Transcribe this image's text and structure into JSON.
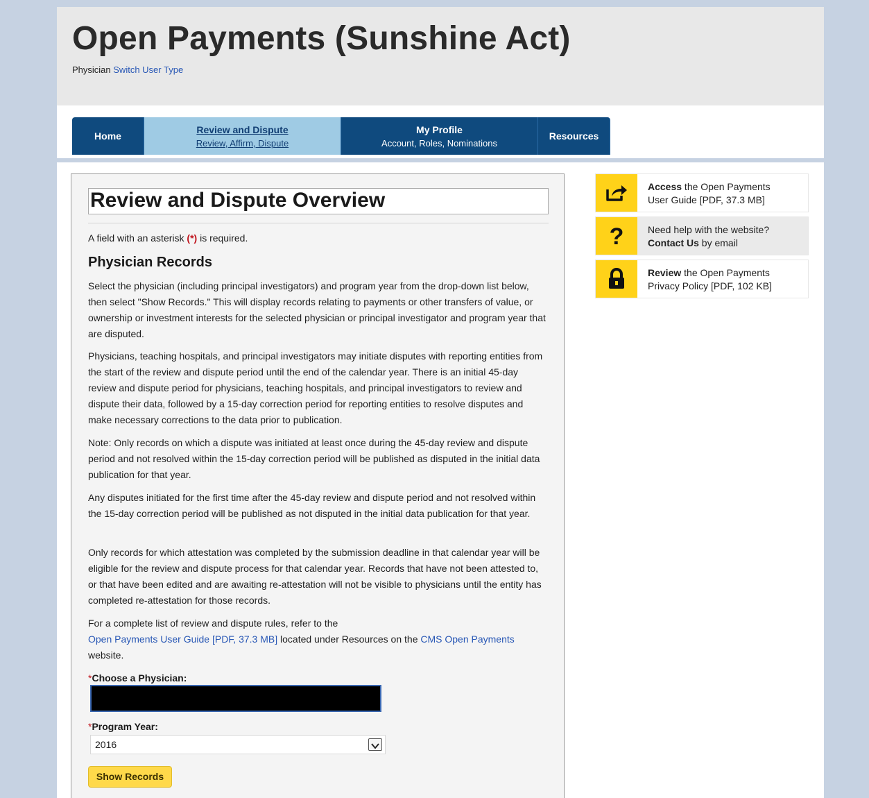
{
  "header": {
    "site_title": "Open Payments (Sunshine Act)",
    "user_type": "Physician",
    "switch_link": "Switch User Type"
  },
  "nav": {
    "home": "Home",
    "review_title": "Review and Dispute",
    "review_sub": "Review, Affirm, Dispute",
    "profile_title": "My Profile",
    "profile_sub": "Account, Roles, Nominations",
    "resources": "Resources"
  },
  "main": {
    "title": "Review and Dispute Overview",
    "required_note_pre": "A field with an asterisk ",
    "required_note_ast": "(*)",
    "required_note_post": " is required.",
    "section_title": "Physician Records",
    "p1": "Select the physician (including principal investigators) and program year from the drop-down list below, then select \"Show Records.\" This will display records relating to payments or other transfers of value, or ownership or investment interests for the selected physician or principal investigator and program year that are disputed.",
    "p2": "Physicians, teaching hospitals, and principal investigators may initiate disputes with reporting entities from the start of the review and dispute period until the end of the calendar year. There is an initial 45-day review and dispute period for physicians, teaching hospitals, and principal investigators to review and dispute their data, followed by a 15-day correction period for reporting entities to resolve disputes and make necessary corrections to the data prior to publication.",
    "p3": "Note: Only records on which a dispute was initiated at least once during the 45-day review and dispute period and not resolved within the 15-day correction period will be published as disputed in the initial data publication for that year.",
    "p4": "Any disputes initiated for the first time after the 45-day review and dispute period and not resolved within the 15-day correction period will be published as not disputed in the initial data publication for that year.",
    "p5": "Only records for which attestation was completed by the submission deadline in that calendar year will be eligible for the review and dispute process for that calendar year. Records that have not been attested to, or that have been edited and are awaiting re-attestation will not be visible to physicians until the entity has completed re-attestation for those records.",
    "p6_pre": "For a complete list of review and dispute rules, refer to the",
    "p6_link1": "Open Payments User Guide [PDF, 37.3 MB]",
    "p6_mid": " located under Resources on the ",
    "p6_link2": "CMS Open Payments",
    "p6_post": " website.",
    "asterisk": "*",
    "physician_label": "Choose a Physician:",
    "year_label": "Program Year:",
    "year_value": "2016",
    "show_button": "Show Records"
  },
  "sidebar": {
    "card1_bold": "Access",
    "card1_rest": " the Open Payments",
    "card1_line2": "User Guide [PDF, 37.3 MB]",
    "card2_line1": "Need help with the website?",
    "card2_bold": "Contact Us",
    "card2_rest": " by email",
    "card3_bold": "Review",
    "card3_rest": " the Open Payments",
    "card3_line2": "Privacy Policy [PDF, 102 KB]",
    "icons": [
      "share-arrow-icon",
      "question-mark-icon",
      "lock-icon"
    ],
    "icon_color": "#ffd219"
  },
  "colors": {
    "nav": "#0f4a7e",
    "nav_active": "#9fcbe4",
    "link": "#2857b5",
    "button": "#ffd94a",
    "background": "#c6d2e2"
  }
}
